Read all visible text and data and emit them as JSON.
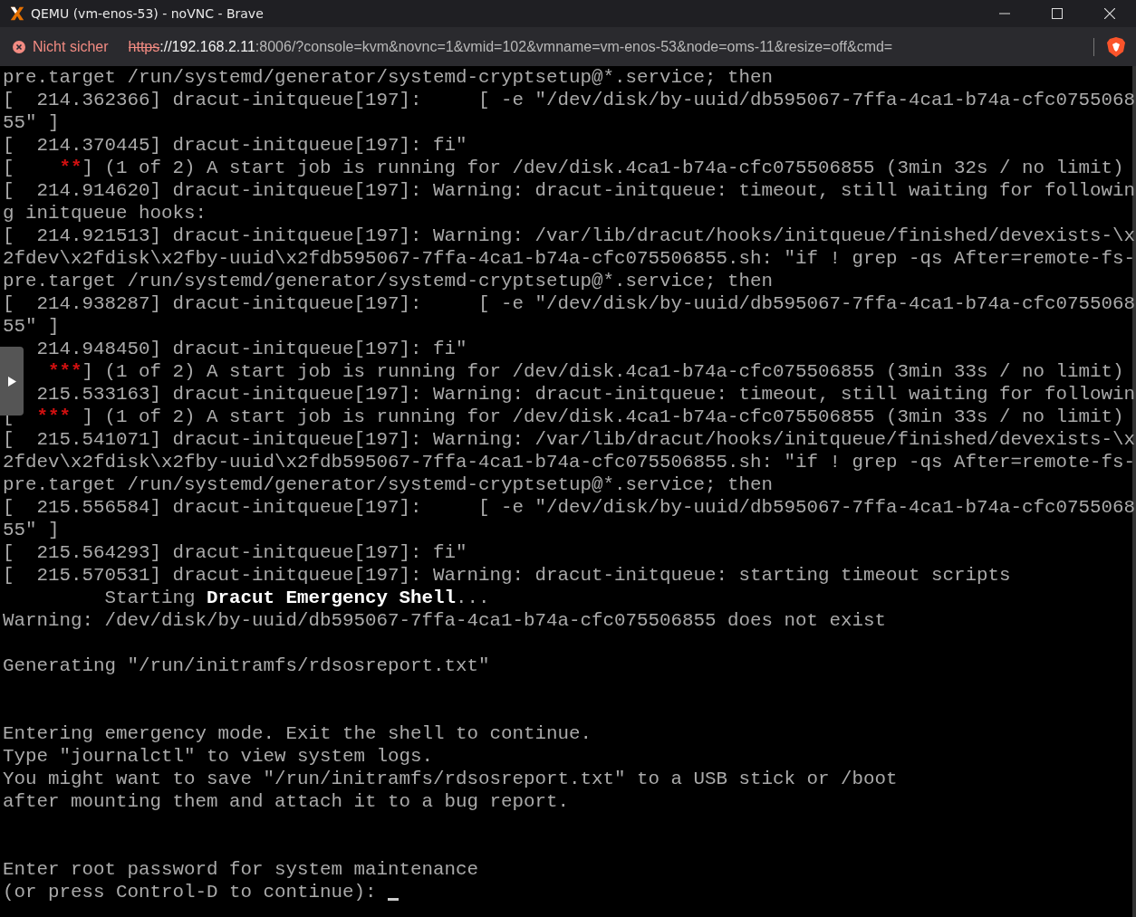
{
  "window": {
    "title": "QEMU (vm-enos-53) - noVNC - Brave"
  },
  "address_bar": {
    "security_label": "Nicht sicher",
    "url_scheme": "https",
    "url_host": "://192.168.2.11",
    "url_rest": ":8006/?console=kvm&novnc=1&vmid=102&vmname=vm-enos-53&node=oms-11&resize=off&cmd="
  },
  "console": {
    "cursor_visible": true,
    "lines": [
      {
        "kind": "text",
        "segments": [
          {
            "text": "pre.target /run/systemd/generator/systemd-cryptsetup@*.service; then"
          }
        ]
      },
      {
        "kind": "text",
        "segments": [
          {
            "text": "[  214.362366] dracut-initqueue[197]:     [ -e \"/dev/disk/by-uuid/db595067-7ffa-4ca1-b74a-cfc0755068"
          }
        ]
      },
      {
        "kind": "text",
        "segments": [
          {
            "text": "55\" ]"
          }
        ]
      },
      {
        "kind": "text",
        "segments": [
          {
            "text": "[  214.370445] dracut-initqueue[197]: fi\""
          }
        ]
      },
      {
        "kind": "text",
        "segments": [
          {
            "text": "[    "
          },
          {
            "text": "**",
            "kind": "alert"
          },
          {
            "text": "] (1 of 2) A start job is running for /dev/disk.4ca1-b74a-cfc075506855 (3min 32s / no limit)"
          }
        ]
      },
      {
        "kind": "text",
        "segments": [
          {
            "text": "[  214.914620] dracut-initqueue[197]: Warning: dracut-initqueue: timeout, still waiting for followin"
          }
        ]
      },
      {
        "kind": "text",
        "segments": [
          {
            "text": "g initqueue hooks:"
          }
        ]
      },
      {
        "kind": "text",
        "segments": [
          {
            "text": "[  214.921513] dracut-initqueue[197]: Warning: /var/lib/dracut/hooks/initqueue/finished/devexists-\\x"
          }
        ]
      },
      {
        "kind": "text",
        "segments": [
          {
            "text": "2fdev\\x2fdisk\\x2fby-uuid\\x2fdb595067-7ffa-4ca1-b74a-cfc075506855.sh: \"if ! grep -qs After=remote-fs-"
          }
        ]
      },
      {
        "kind": "text",
        "segments": [
          {
            "text": "pre.target /run/systemd/generator/systemd-cryptsetup@*.service; then"
          }
        ]
      },
      {
        "kind": "text",
        "segments": [
          {
            "text": "[  214.938287] dracut-initqueue[197]:     [ -e \"/dev/disk/by-uuid/db595067-7ffa-4ca1-b74a-cfc0755068"
          }
        ]
      },
      {
        "kind": "text",
        "segments": [
          {
            "text": "55\" ]"
          }
        ]
      },
      {
        "kind": "text",
        "segments": [
          {
            "text": "   214.948450] dracut-initqueue[197]: fi\""
          }
        ]
      },
      {
        "kind": "covered_start",
        "segments": [
          {
            "text": "***",
            "kind": "alert"
          },
          {
            "text": "] (1 of 2) A start job is running for /dev/disk.4ca1-b74a-cfc075506855 (3min 33s / no limit)"
          }
        ]
      },
      {
        "kind": "text",
        "segments": [
          {
            "text": "   215.533163] dracut-initqueue[197]: Warning: dracut-initqueue: timeout, still waiting for followin"
          }
        ]
      },
      {
        "kind": "text",
        "segments": [
          {
            "text": "[  "
          },
          {
            "text": "***",
            "kind": "alert"
          },
          {
            "text": " ] (1 of 2) A start job is running for /dev/disk.4ca1-b74a-cfc075506855 (3min 33s / no limit)"
          }
        ]
      },
      {
        "kind": "text",
        "segments": [
          {
            "text": "[  215.541071] dracut-initqueue[197]: Warning: /var/lib/dracut/hooks/initqueue/finished/devexists-\\x"
          }
        ]
      },
      {
        "kind": "text",
        "segments": [
          {
            "text": "2fdev\\x2fdisk\\x2fby-uuid\\x2fdb595067-7ffa-4ca1-b74a-cfc075506855.sh: \"if ! grep -qs After=remote-fs-"
          }
        ]
      },
      {
        "kind": "text",
        "segments": [
          {
            "text": "pre.target /run/systemd/generator/systemd-cryptsetup@*.service; then"
          }
        ]
      },
      {
        "kind": "text",
        "segments": [
          {
            "text": "[  215.556584] dracut-initqueue[197]:     [ -e \"/dev/disk/by-uuid/db595067-7ffa-4ca1-b74a-cfc0755068"
          }
        ]
      },
      {
        "kind": "text",
        "segments": [
          {
            "text": "55\" ]"
          }
        ]
      },
      {
        "kind": "text",
        "segments": [
          {
            "text": "[  215.564293] dracut-initqueue[197]: fi\""
          }
        ]
      },
      {
        "kind": "text",
        "segments": [
          {
            "text": "[  215.570531] dracut-initqueue[197]: Warning: dracut-initqueue: starting timeout scripts"
          }
        ]
      },
      {
        "kind": "text",
        "segments": [
          {
            "text": "         Starting "
          },
          {
            "text": "Dracut Emergency Shell",
            "kind": "bright"
          },
          {
            "text": "..."
          }
        ]
      },
      {
        "kind": "text",
        "segments": [
          {
            "text": "Warning: /dev/disk/by-uuid/db595067-7ffa-4ca1-b74a-cfc075506855 does not exist"
          }
        ]
      },
      {
        "kind": "blank"
      },
      {
        "kind": "text",
        "segments": [
          {
            "text": "Generating \"/run/initramfs/rdsosreport.txt\""
          }
        ]
      },
      {
        "kind": "blank"
      },
      {
        "kind": "blank"
      },
      {
        "kind": "text",
        "segments": [
          {
            "text": "Entering emergency mode. Exit the shell to continue."
          }
        ]
      },
      {
        "kind": "text",
        "segments": [
          {
            "text": "Type \"journalctl\" to view system logs."
          }
        ]
      },
      {
        "kind": "text",
        "segments": [
          {
            "text": "You might want to save \"/run/initramfs/rdsosreport.txt\" to a USB stick or /boot"
          }
        ]
      },
      {
        "kind": "text",
        "segments": [
          {
            "text": "after mounting them and attach it to a bug report."
          }
        ]
      },
      {
        "kind": "blank"
      },
      {
        "kind": "blank"
      },
      {
        "kind": "text",
        "segments": [
          {
            "text": "Enter root password for system maintenance"
          }
        ]
      },
      {
        "kind": "prompt",
        "segments": [
          {
            "text": "(or press Control-D to continue): "
          }
        ]
      }
    ]
  }
}
